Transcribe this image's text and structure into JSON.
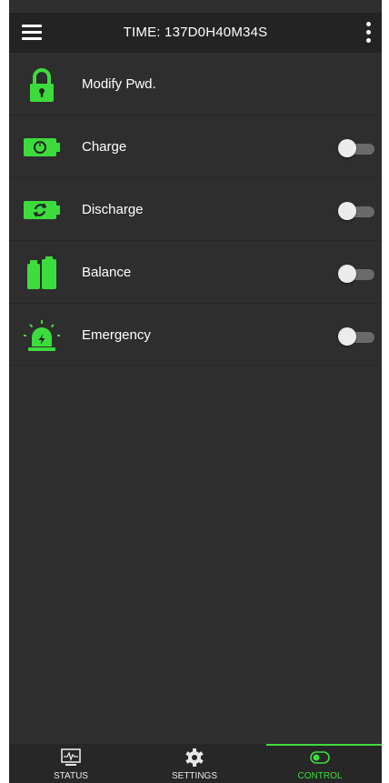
{
  "header": {
    "title": "TIME: 137D0H40M34S",
    "menu_icon": "hamburger-menu-icon",
    "more_icon": "more-vertical-icon"
  },
  "controls": [
    {
      "label": "Modify Pwd.",
      "icon": "lock-icon",
      "has_toggle": false
    },
    {
      "label": "Charge",
      "icon": "battery-charge-icon",
      "has_toggle": true,
      "toggle_on": false
    },
    {
      "label": "Discharge",
      "icon": "battery-discharge-icon",
      "has_toggle": true,
      "toggle_on": false
    },
    {
      "label": "Balance",
      "icon": "balance-icon",
      "has_toggle": true,
      "toggle_on": false
    },
    {
      "label": "Emergency",
      "icon": "emergency-light-icon",
      "has_toggle": true,
      "toggle_on": false
    }
  ],
  "bottom_nav": [
    {
      "label": "STATUS",
      "icon": "monitor-status-icon",
      "active": false
    },
    {
      "label": "SETTINGS",
      "icon": "gear-icon",
      "active": false
    },
    {
      "label": "CONTROL",
      "icon": "toggle-icon",
      "active": true
    }
  ],
  "colors": {
    "accent": "#3ddc3d",
    "background": "#2f2f2f",
    "header": "#222322",
    "row": "#2d2e2d"
  }
}
